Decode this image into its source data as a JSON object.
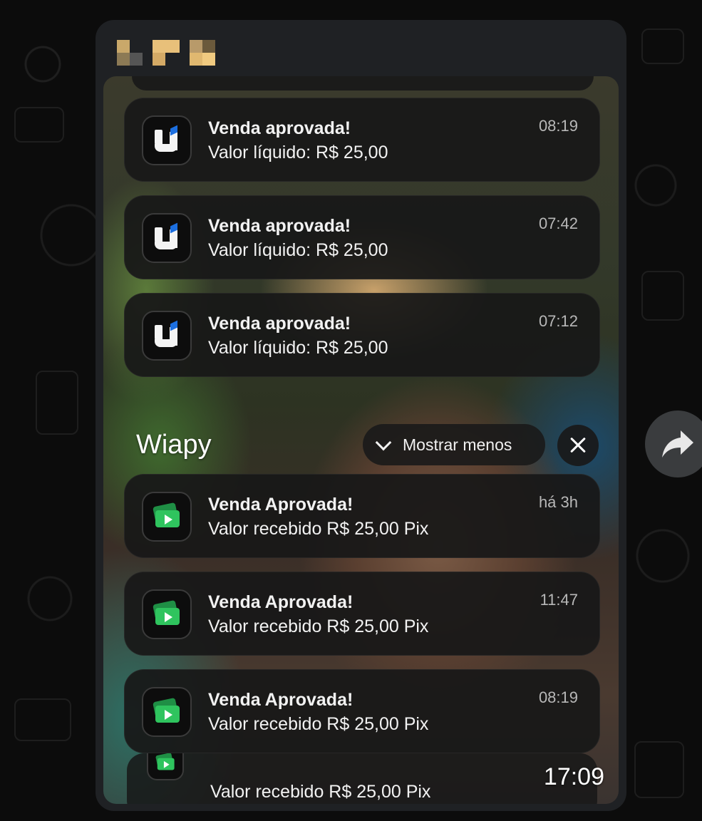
{
  "chat": {
    "sender_name_pixelated": true,
    "forward_icon": "forward-icon"
  },
  "lock_screen": {
    "clock": "17:09",
    "group": {
      "name": "Wiapy",
      "show_less_label": "Mostrar menos",
      "collapse_icon": "chevron-down-icon",
      "close_icon": "close-icon"
    },
    "notifications_upper": [
      {
        "app_icon": "u-app-icon",
        "title": "Venda aprovada!",
        "body": "Valor líquido: R$ 25,00",
        "time": "08:19"
      },
      {
        "app_icon": "u-app-icon",
        "title": "Venda aprovada!",
        "body": "Valor líquido: R$ 25,00",
        "time": "07:42"
      },
      {
        "app_icon": "u-app-icon",
        "title": "Venda aprovada!",
        "body": "Valor líquido: R$ 25,00",
        "time": "07:12"
      }
    ],
    "notifications_lower": [
      {
        "app_icon": "cash-app-icon",
        "title": "Venda Aprovada!",
        "body": "Valor recebido R$ 25,00 Pix",
        "time": "há 3h"
      },
      {
        "app_icon": "cash-app-icon",
        "title": "Venda Aprovada!",
        "body": "Valor recebido R$ 25,00 Pix",
        "time": "11:47"
      },
      {
        "app_icon": "cash-app-icon",
        "title": "Venda Aprovada!",
        "body": "Valor recebido R$ 25,00 Pix",
        "time": "08:19"
      }
    ],
    "peek_bottom": {
      "body": "Valor recebido R$ 25,00 Pix"
    }
  },
  "colors": {
    "bubble": "#1f2124",
    "card": "#181818",
    "cash_green": "#2fc45e",
    "u_accent": "#1c6fe0"
  }
}
